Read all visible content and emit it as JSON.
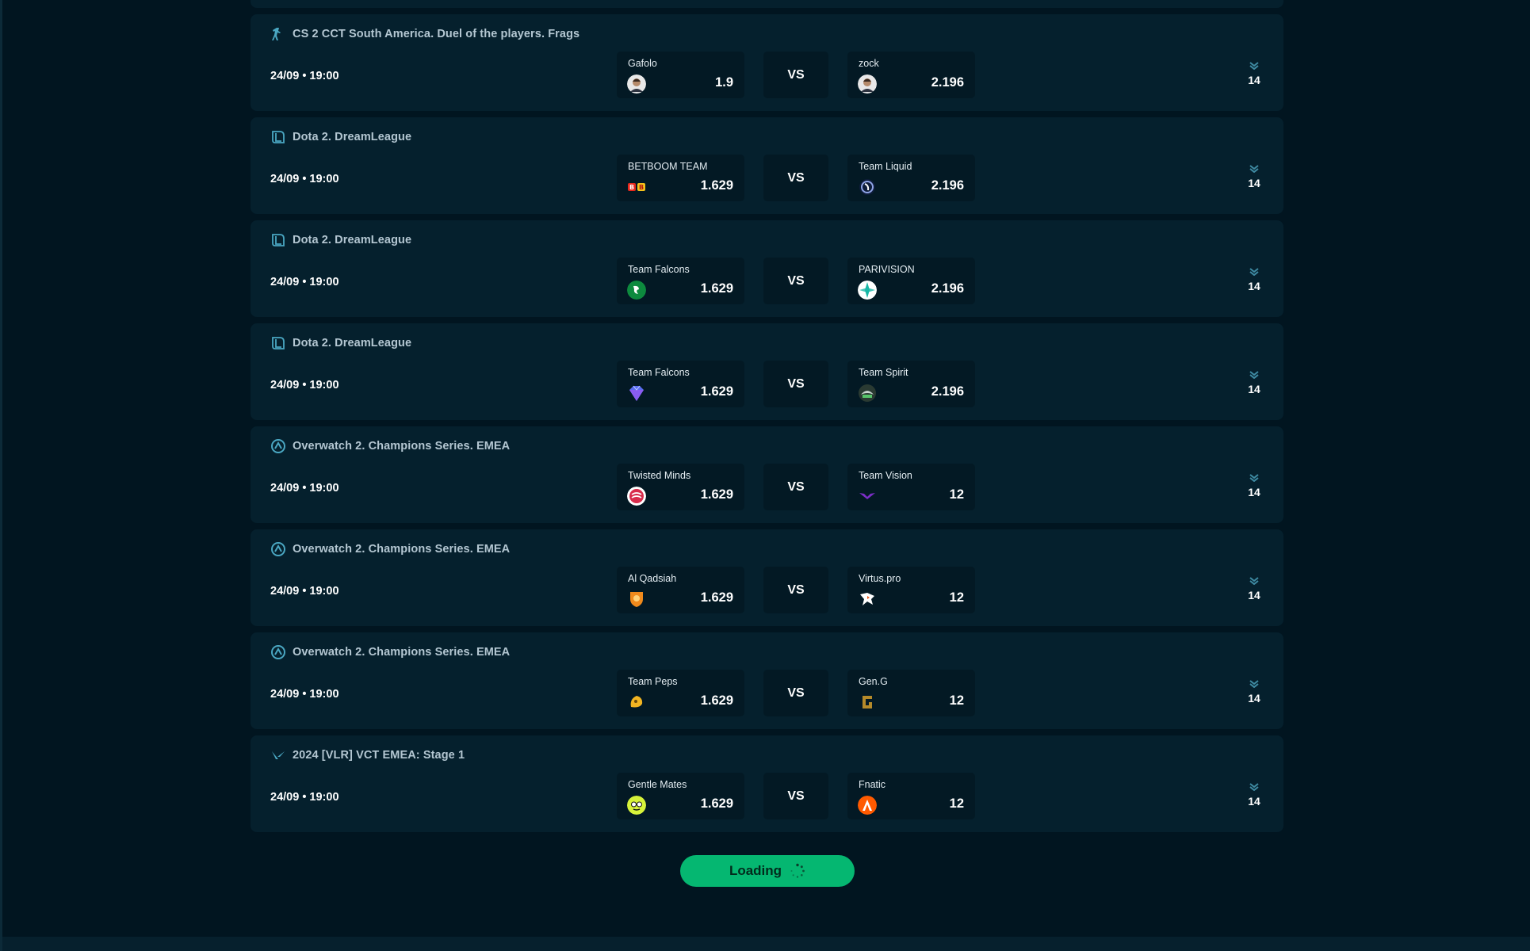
{
  "colors": {
    "background": "#011520",
    "card": "#05202d",
    "inner_card": "#031924",
    "accent": "#05b771",
    "league_text": "#b4c7d2",
    "icon_teal": "#4aa7c2"
  },
  "matches": [
    {
      "league": "CS 2 CCT South America. Duel of the players. Frags",
      "league_icon": "counter-strike-icon",
      "time": "24/09 • 19:00",
      "home": {
        "name": "Gafolo",
        "odds": "1.9",
        "logo": "player-avatar"
      },
      "vs": "VS",
      "away": {
        "name": "zock",
        "odds": "2.196",
        "logo": "player-avatar"
      },
      "more": "14"
    },
    {
      "league": "Dota 2. DreamLeague",
      "league_icon": "dota-icon",
      "time": "24/09 • 19:00",
      "home": {
        "name": "BETBOOM TEAM",
        "odds": "1.629",
        "logo": "betboom-logo"
      },
      "vs": "VS",
      "away": {
        "name": "Team Liquid",
        "odds": "2.196",
        "logo": "liquid-logo"
      },
      "more": "14"
    },
    {
      "league": "Dota 2. DreamLeague",
      "league_icon": "dota-icon",
      "time": "24/09 • 19:00",
      "home": {
        "name": "Team Falcons",
        "odds": "1.629",
        "logo": "falcons-logo"
      },
      "vs": "VS",
      "away": {
        "name": "PARIVISION",
        "odds": "2.196",
        "logo": "parivision-logo"
      },
      "more": "14"
    },
    {
      "league": "Dota 2. DreamLeague",
      "league_icon": "dota-icon",
      "time": "24/09 • 19:00",
      "home": {
        "name": "Team Falcons",
        "odds": "1.629",
        "logo": "diamond-logo"
      },
      "vs": "VS",
      "away": {
        "name": "Team Spirit",
        "odds": "2.196",
        "logo": "spirit-logo"
      },
      "more": "14"
    },
    {
      "league": "Overwatch 2. Champions Series. EMEA",
      "league_icon": "overwatch-icon",
      "time": "24/09 • 19:00",
      "home": {
        "name": "Twisted Minds",
        "odds": "1.629",
        "logo": "twisted-minds-logo"
      },
      "vs": "VS",
      "away": {
        "name": "Team Vision",
        "odds": "12",
        "logo": "vision-logo"
      },
      "more": "14"
    },
    {
      "league": "Overwatch 2. Champions Series. EMEA",
      "league_icon": "overwatch-icon",
      "time": "24/09 • 19:00",
      "home": {
        "name": "Al Qadsiah",
        "odds": "1.629",
        "logo": "qadsiah-logo"
      },
      "vs": "VS",
      "away": {
        "name": "Virtus.pro",
        "odds": "12",
        "logo": "virtuspro-logo"
      },
      "more": "14"
    },
    {
      "league": "Overwatch 2. Champions Series. EMEA",
      "league_icon": "overwatch-icon",
      "time": "24/09 • 19:00",
      "home": {
        "name": "Team Peps",
        "odds": "1.629",
        "logo": "peps-logo"
      },
      "vs": "VS",
      "away": {
        "name": "Gen.G",
        "odds": "12",
        "logo": "geng-logo"
      },
      "more": "14"
    },
    {
      "league": "2024 [VLR] VCT EMEA: Stage 1",
      "league_icon": "valorant-icon",
      "time": "24/09 • 19:00",
      "home": {
        "name": "Gentle Mates",
        "odds": "1.629",
        "logo": "gentle-mates-logo"
      },
      "vs": "VS",
      "away": {
        "name": "Fnatic",
        "odds": "12",
        "logo": "fnatic-logo"
      },
      "more": "14"
    }
  ],
  "load_more": {
    "label": "Loading",
    "icon": "spinner-icon"
  }
}
